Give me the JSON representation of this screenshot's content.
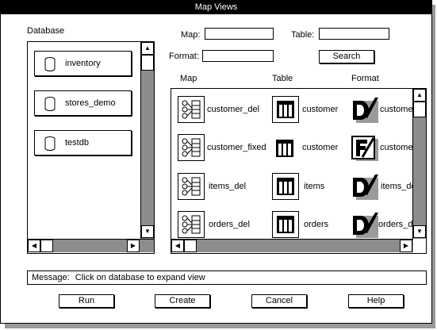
{
  "window": {
    "title": "Map Views"
  },
  "search": {
    "map_label": "Map:",
    "map_value": "",
    "table_label": "Table:",
    "table_value": "",
    "format_label": "Format:",
    "format_value": "",
    "search_button": "Search"
  },
  "database": {
    "label": "Database",
    "items": [
      {
        "name": "inventory"
      },
      {
        "name": "stores_demo"
      },
      {
        "name": "testdb"
      }
    ]
  },
  "results": {
    "headers": {
      "map": "Map",
      "table": "Table",
      "format": "Format"
    },
    "rows": [
      {
        "map": "customer_del",
        "table": "customer",
        "format": "customer_del",
        "format_icon": "delimited-format-icon"
      },
      {
        "map": "customer_fixed",
        "table": "customer",
        "format": "customer_fixed",
        "format_icon": "fixed-format-icon"
      },
      {
        "map": "items_del",
        "table": "items",
        "format": "items_del",
        "format_icon": "delimited-format-icon"
      },
      {
        "map": "orders_del",
        "table": "orders",
        "format": "orders_del",
        "format_icon": "delimited-format-icon"
      }
    ]
  },
  "message": {
    "label": "Message:",
    "text": "Click on database to expand view"
  },
  "actions": {
    "run": "Run",
    "create": "Create",
    "cancel": "Cancel",
    "help": "Help"
  },
  "icons": {
    "up": "up-arrow-icon",
    "down": "down-arrow-icon",
    "left": "left-arrow-icon",
    "right": "right-arrow-icon",
    "database": "database-cylinder-icon",
    "map": "map-icon",
    "table": "table-icon"
  },
  "colors": {
    "titlebar": "#000000",
    "scrolltrack": "#8c8c8c",
    "shadow": "#9a9a9a"
  }
}
